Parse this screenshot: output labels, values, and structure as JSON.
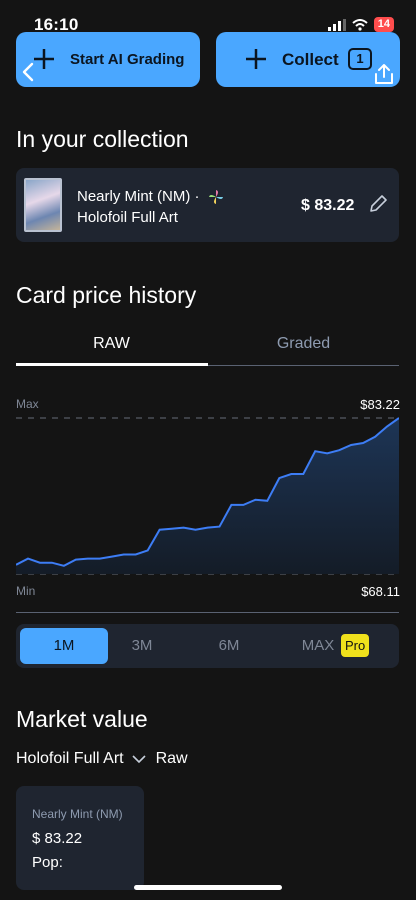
{
  "status": {
    "time": "16:10",
    "battery": "14"
  },
  "actions": {
    "ai_grading_label": "Start AI Grading",
    "collect_label": "Collect",
    "collect_count": "1"
  },
  "collection": {
    "title": "In your collection",
    "condition_line1": "Nearly Mint (NM) ·",
    "condition_line2": "Holofoil Full Art",
    "price": "$ 83.22"
  },
  "price_history": {
    "title": "Card price history",
    "tabs": [
      "RAW",
      "Graded"
    ],
    "active_tab": "RAW",
    "max_label": "Max",
    "max_value": "$83.22",
    "min_label": "Min",
    "min_value": "$68.11",
    "ranges": [
      "1M",
      "3M",
      "6M",
      "MAX"
    ],
    "active_range": "1M",
    "pro_badge": "Pro"
  },
  "chart_data": {
    "type": "area",
    "title": "",
    "xlabel": "",
    "ylabel": "",
    "ylim": [
      68.11,
      83.22
    ],
    "grid": false,
    "values": [
      69.0,
      69.6,
      69.2,
      69.2,
      68.9,
      69.5,
      69.6,
      69.6,
      69.8,
      70.0,
      70.0,
      70.4,
      72.4,
      72.5,
      72.6,
      72.4,
      72.6,
      72.7,
      74.8,
      74.8,
      75.3,
      75.2,
      77.4,
      77.8,
      77.8,
      80.0,
      79.8,
      80.1,
      80.6,
      80.8,
      81.4,
      82.4,
      83.22
    ],
    "colors": {
      "line": "#3d7df5",
      "fill_top": "#1d3556",
      "fill_bottom": "#141c27"
    }
  },
  "market": {
    "title": "Market value",
    "variant": "Holofoil Full Art",
    "type": "Raw",
    "card_condition": "Nearly Mint (NM)",
    "card_price": "$ 83.22",
    "card_pop": "Pop:"
  },
  "icons": {
    "plus": "plus-icon",
    "back": "chevron-left-icon",
    "share": "share-icon",
    "edit": "pencil-icon",
    "variant_dropdown": "chevron-down-icon"
  }
}
